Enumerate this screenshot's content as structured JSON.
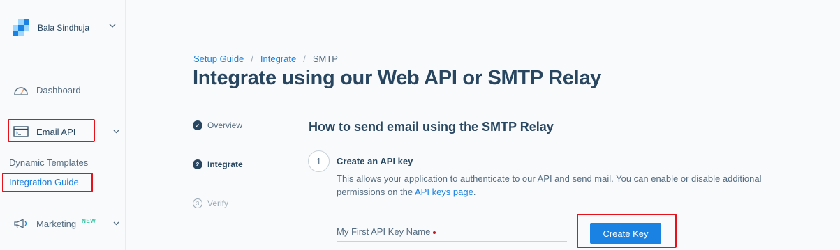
{
  "sidebar": {
    "account_name": "Bala Sindhuja",
    "dashboard_label": "Dashboard",
    "email_api_label": "Email API",
    "dynamic_templates_label": "Dynamic Templates",
    "integration_guide_label": "Integration Guide",
    "marketing_label": "Marketing",
    "marketing_badge": "NEW"
  },
  "breadcrumb": {
    "setup_guide": "Setup Guide",
    "integrate": "Integrate",
    "current": "SMTP",
    "separator": "/"
  },
  "page_title": "Integrate using our Web API or SMTP Relay",
  "stepper": {
    "steps": [
      {
        "label": "Overview",
        "marker": "✓",
        "state": "done"
      },
      {
        "label": "Integrate",
        "marker": "2",
        "state": "active"
      },
      {
        "label": "Verify",
        "marker": "3",
        "state": "pending"
      }
    ]
  },
  "content": {
    "section_title": "How to send email using the SMTP Relay",
    "step_number": "1",
    "step_heading": "Create an API key",
    "step_desc_before": "This allows your application to authenticate to our API and send mail. You can enable or disable additional permissions on the ",
    "step_desc_link": "API keys page",
    "step_desc_after": ".",
    "api_key_placeholder": "My First API Key Name",
    "create_key_label": "Create Key"
  },
  "colors": {
    "accent": "#1a82e2",
    "highlight": "#e8101a",
    "text_primary": "#294661",
    "text_secondary": "#546b81"
  }
}
